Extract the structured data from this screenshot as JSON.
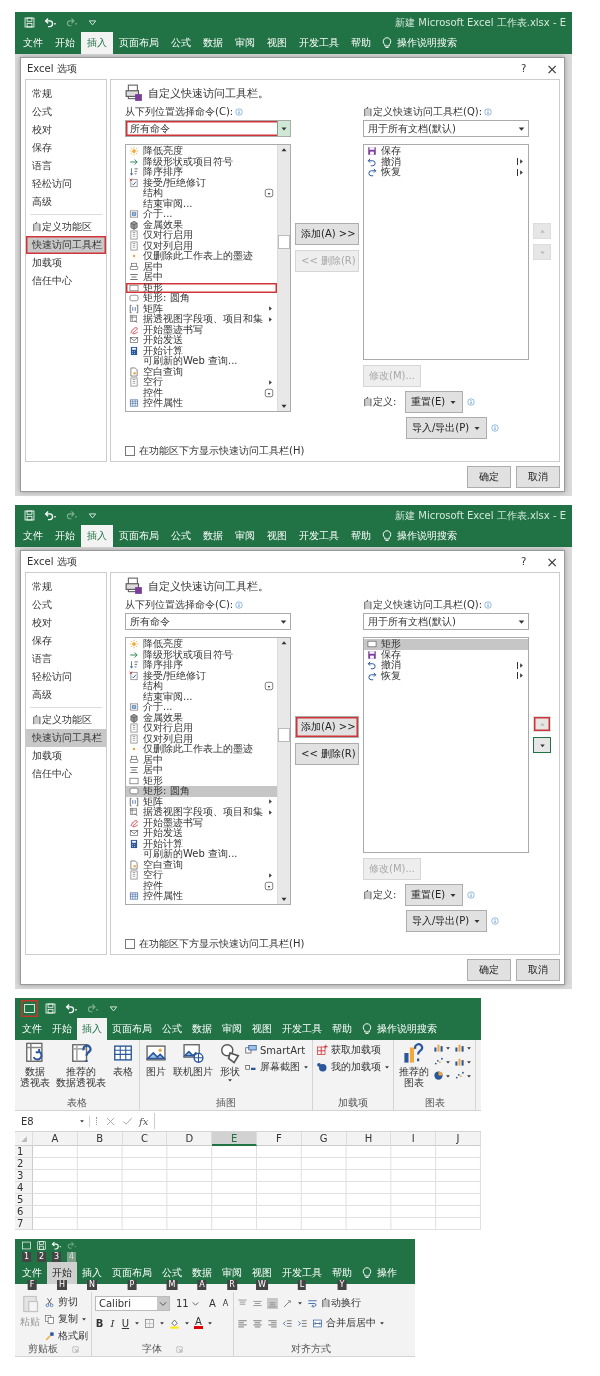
{
  "screens": [
    {
      "kind": "options",
      "document_title": "新建 Microsoft Excel 工作表.xlsx - E",
      "qat": [
        {
          "kind": "save",
          "highlighted": false
        },
        {
          "kind": "undo",
          "highlighted": false
        },
        {
          "kind": "redo",
          "highlighted": false
        },
        {
          "kind": "customize",
          "highlighted": false
        }
      ],
      "tabs": [
        {
          "label": "文件",
          "selected": false
        },
        {
          "label": "开始",
          "selected": false
        },
        {
          "label": "插入",
          "selected": true
        },
        {
          "label": "页面布局",
          "selected": false
        },
        {
          "label": "公式",
          "selected": false
        },
        {
          "label": "数据",
          "selected": false
        },
        {
          "label": "审阅",
          "selected": false
        },
        {
          "label": "视图",
          "selected": false
        },
        {
          "label": "开发工具",
          "selected": false
        },
        {
          "label": "帮助",
          "selected": false
        }
      ],
      "search": "操作说明搜索",
      "dialog": {
        "title": "Excel 选项",
        "help": "?",
        "close": "×",
        "nav_groups": [
          [
            {
              "label": "常规",
              "selected": false,
              "highlighted": false
            },
            {
              "label": "公式",
              "selected": false,
              "highlighted": false
            },
            {
              "label": "校对",
              "selected": false,
              "highlighted": false
            },
            {
              "label": "保存",
              "selected": false,
              "highlighted": false
            },
            {
              "label": "语言",
              "selected": false,
              "highlighted": false
            },
            {
              "label": "轻松访问",
              "selected": false,
              "highlighted": false
            },
            {
              "label": "高级",
              "selected": false,
              "highlighted": false
            }
          ],
          [
            {
              "label": "自定义功能区",
              "selected": false,
              "highlighted": false
            },
            {
              "label": "快速访问工具栏",
              "selected": true,
              "highlighted": true
            },
            {
              "label": "加载项",
              "selected": false,
              "highlighted": false
            },
            {
              "label": "信任中心",
              "selected": false,
              "highlighted": false
            }
          ]
        ],
        "heading": "自定义快速访问工具栏。",
        "source_label": "从下列位置选择命令(C):",
        "source": {
          "value": "所有命令",
          "highlighted": true
        },
        "target_label": "自定义快速访问工具栏(Q):",
        "target": {
          "value": "用于所有文档(默认)",
          "highlighted": false
        },
        "commands": [
          {
            "label": "降低亮度",
            "kind": "sun",
            "submenu": false,
            "split": false,
            "selected": false,
            "highlighted": false
          },
          {
            "label": "降级形状或项目符号",
            "kind": "arrow",
            "submenu": false,
            "split": false,
            "selected": false,
            "highlighted": false
          },
          {
            "label": "降序排序",
            "kind": "sort",
            "submenu": false,
            "split": false,
            "selected": false,
            "highlighted": false
          },
          {
            "label": "接受/拒绝修订",
            "kind": "check",
            "submenu": false,
            "split": false,
            "selected": false,
            "highlighted": false
          },
          {
            "label": "结构",
            "kind": "none",
            "submenu": false,
            "split": true,
            "selected": false,
            "highlighted": false
          },
          {
            "label": "结束审阅...",
            "kind": "none",
            "submenu": false,
            "split": false,
            "selected": false,
            "highlighted": false
          },
          {
            "label": "介于...",
            "kind": "frame",
            "submenu": false,
            "split": false,
            "selected": false,
            "highlighted": false
          },
          {
            "label": "金属效果",
            "kind": "cube",
            "submenu": false,
            "split": false,
            "selected": false,
            "highlighted": false
          },
          {
            "label": "仅对行启用",
            "kind": "page",
            "submenu": false,
            "split": false,
            "selected": false,
            "highlighted": false
          },
          {
            "label": "仅对列启用",
            "kind": "page",
            "submenu": false,
            "split": false,
            "selected": false,
            "highlighted": false
          },
          {
            "label": "仅删除此工作表上的墨迹",
            "kind": "dot",
            "submenu": false,
            "split": false,
            "selected": false,
            "highlighted": false
          },
          {
            "label": "居中",
            "kind": "print",
            "submenu": false,
            "split": false,
            "selected": false,
            "highlighted": false
          },
          {
            "label": "居中",
            "kind": "lines",
            "submenu": false,
            "split": false,
            "selected": false,
            "highlighted": false
          },
          {
            "label": "矩形",
            "kind": "rect",
            "submenu": false,
            "split": false,
            "selected": false,
            "highlighted": true
          },
          {
            "label": "矩形: 圆角",
            "kind": "roundrect",
            "submenu": false,
            "split": false,
            "selected": false,
            "highlighted": false
          },
          {
            "label": "矩阵",
            "kind": "bracket",
            "submenu": true,
            "split": false,
            "selected": false,
            "highlighted": false
          },
          {
            "label": "据透视图字段项、项目和集",
            "kind": "pivot",
            "submenu": true,
            "split": false,
            "selected": false,
            "highlighted": false
          },
          {
            "label": "开始墨迹书写",
            "kind": "ink",
            "submenu": false,
            "split": false,
            "selected": false,
            "highlighted": false
          },
          {
            "label": "开始发送",
            "kind": "send",
            "submenu": false,
            "split": false,
            "selected": false,
            "highlighted": false
          },
          {
            "label": "开始计算",
            "kind": "calc",
            "submenu": false,
            "split": false,
            "selected": false,
            "highlighted": false
          },
          {
            "label": "可刷新的Web 查询...",
            "kind": "none",
            "submenu": false,
            "split": false,
            "selected": false,
            "highlighted": false
          },
          {
            "label": "空白查询",
            "kind": "query",
            "submenu": false,
            "split": false,
            "selected": false,
            "highlighted": false
          },
          {
            "label": "空行",
            "kind": "page",
            "submenu": true,
            "split": false,
            "selected": false,
            "highlighted": false
          },
          {
            "label": "控件",
            "kind": "none",
            "submenu": false,
            "split": true,
            "selected": false,
            "highlighted": false
          },
          {
            "label": "控件属性",
            "kind": "grid",
            "submenu": false,
            "split": false,
            "selected": false,
            "highlighted": false
          }
        ],
        "toolbar": [
          {
            "label": "保存",
            "kind": "save",
            "submenu": false,
            "selected": false
          },
          {
            "label": "撤消",
            "kind": "undo",
            "submenu": true,
            "selected": false
          },
          {
            "label": "恢复",
            "kind": "redo",
            "submenu": true,
            "selected": false
          }
        ],
        "add_button": {
          "label": "添加(A) >>",
          "disabled": false,
          "highlighted": false
        },
        "remove_button": {
          "label": "<< 删除(R)",
          "disabled": true,
          "highlighted": false
        },
        "modify_button": {
          "label": "修改(M)...",
          "disabled": true
        },
        "customize_label": "自定义:",
        "reset_button": "重置(E)",
        "import_button": "导入/导出(P)",
        "move_up": {
          "disabled": true,
          "highlighted": false,
          "focused": false
        },
        "move_down": {
          "disabled": true,
          "highlighted": false,
          "focused": false
        },
        "show_below": {
          "label": "在功能区下方显示快速访问工具栏(H)",
          "checked": false
        },
        "ok": "确定",
        "cancel": "取消"
      }
    },
    {
      "kind": "options",
      "document_title": "新建 Microsoft Excel 工作表.xlsx - E",
      "qat": [
        {
          "kind": "save",
          "highlighted": false
        },
        {
          "kind": "undo",
          "highlighted": false
        },
        {
          "kind": "redo",
          "highlighted": false
        },
        {
          "kind": "customize",
          "highlighted": false
        }
      ],
      "tabs": [
        {
          "label": "文件",
          "selected": false
        },
        {
          "label": "开始",
          "selected": false
        },
        {
          "label": "插入",
          "selected": true
        },
        {
          "label": "页面布局",
          "selected": false
        },
        {
          "label": "公式",
          "selected": false
        },
        {
          "label": "数据",
          "selected": false
        },
        {
          "label": "审阅",
          "selected": false
        },
        {
          "label": "视图",
          "selected": false
        },
        {
          "label": "开发工具",
          "selected": false
        },
        {
          "label": "帮助",
          "selected": false
        }
      ],
      "search": "操作说明搜索",
      "dialog": {
        "title": "Excel 选项",
        "help": "?",
        "close": "×",
        "nav_groups": [
          [
            {
              "label": "常规",
              "selected": false,
              "highlighted": false
            },
            {
              "label": "公式",
              "selected": false,
              "highlighted": false
            },
            {
              "label": "校对",
              "selected": false,
              "highlighted": false
            },
            {
              "label": "保存",
              "selected": false,
              "highlighted": false
            },
            {
              "label": "语言",
              "selected": false,
              "highlighted": false
            },
            {
              "label": "轻松访问",
              "selected": false,
              "highlighted": false
            },
            {
              "label": "高级",
              "selected": false,
              "highlighted": false
            }
          ],
          [
            {
              "label": "自定义功能区",
              "selected": false,
              "highlighted": false
            },
            {
              "label": "快速访问工具栏",
              "selected": true,
              "highlighted": false
            },
            {
              "label": "加载项",
              "selected": false,
              "highlighted": false
            },
            {
              "label": "信任中心",
              "selected": false,
              "highlighted": false
            }
          ]
        ],
        "heading": "自定义快速访问工具栏。",
        "source_label": "从下列位置选择命令(C):",
        "source": {
          "value": "所有命令",
          "highlighted": false
        },
        "target_label": "自定义快速访问工具栏(Q):",
        "target": {
          "value": "用于所有文档(默认)",
          "highlighted": false
        },
        "commands": [
          {
            "label": "降低亮度",
            "kind": "sun",
            "submenu": false,
            "split": false,
            "selected": false,
            "highlighted": false
          },
          {
            "label": "降级形状或项目符号",
            "kind": "arrow",
            "submenu": false,
            "split": false,
            "selected": false,
            "highlighted": false
          },
          {
            "label": "降序排序",
            "kind": "sort",
            "submenu": false,
            "split": false,
            "selected": false,
            "highlighted": false
          },
          {
            "label": "接受/拒绝修订",
            "kind": "check",
            "submenu": false,
            "split": false,
            "selected": false,
            "highlighted": false
          },
          {
            "label": "结构",
            "kind": "none",
            "submenu": false,
            "split": true,
            "selected": false,
            "highlighted": false
          },
          {
            "label": "结束审阅...",
            "kind": "none",
            "submenu": false,
            "split": false,
            "selected": false,
            "highlighted": false
          },
          {
            "label": "介于...",
            "kind": "frame",
            "submenu": false,
            "split": false,
            "selected": false,
            "highlighted": false
          },
          {
            "label": "金属效果",
            "kind": "cube",
            "submenu": false,
            "split": false,
            "selected": false,
            "highlighted": false
          },
          {
            "label": "仅对行启用",
            "kind": "page",
            "submenu": false,
            "split": false,
            "selected": false,
            "highlighted": false
          },
          {
            "label": "仅对列启用",
            "kind": "page",
            "submenu": false,
            "split": false,
            "selected": false,
            "highlighted": false
          },
          {
            "label": "仅删除此工作表上的墨迹",
            "kind": "dot",
            "submenu": false,
            "split": false,
            "selected": false,
            "highlighted": false
          },
          {
            "label": "居中",
            "kind": "print",
            "submenu": false,
            "split": false,
            "selected": false,
            "highlighted": false
          },
          {
            "label": "居中",
            "kind": "lines",
            "submenu": false,
            "split": false,
            "selected": false,
            "highlighted": false
          },
          {
            "label": "矩形",
            "kind": "rect",
            "submenu": false,
            "split": false,
            "selected": false,
            "highlighted": false
          },
          {
            "label": "矩形: 圆角",
            "kind": "roundrect",
            "submenu": false,
            "split": false,
            "selected": true,
            "highlighted": false
          },
          {
            "label": "矩阵",
            "kind": "bracket",
            "submenu": true,
            "split": false,
            "selected": false,
            "highlighted": false
          },
          {
            "label": "据透视图字段项、项目和集",
            "kind": "pivot",
            "submenu": true,
            "split": false,
            "selected": false,
            "highlighted": false
          },
          {
            "label": "开始墨迹书写",
            "kind": "ink",
            "submenu": false,
            "split": false,
            "selected": false,
            "highlighted": false
          },
          {
            "label": "开始发送",
            "kind": "send",
            "submenu": false,
            "split": false,
            "selected": false,
            "highlighted": false
          },
          {
            "label": "开始计算",
            "kind": "calc",
            "submenu": false,
            "split": false,
            "selected": false,
            "highlighted": false
          },
          {
            "label": "可刷新的Web 查询...",
            "kind": "none",
            "submenu": false,
            "split": false,
            "selected": false,
            "highlighted": false
          },
          {
            "label": "空白查询",
            "kind": "query",
            "submenu": false,
            "split": false,
            "selected": false,
            "highlighted": false
          },
          {
            "label": "空行",
            "kind": "page",
            "submenu": true,
            "split": false,
            "selected": false,
            "highlighted": false
          },
          {
            "label": "控件",
            "kind": "none",
            "submenu": false,
            "split": true,
            "selected": false,
            "highlighted": false
          },
          {
            "label": "控件属性",
            "kind": "grid",
            "submenu": false,
            "split": false,
            "selected": false,
            "highlighted": false
          }
        ],
        "toolbar": [
          {
            "label": "矩形",
            "kind": "rect",
            "submenu": false,
            "selected": true
          },
          {
            "label": "保存",
            "kind": "save",
            "submenu": false,
            "selected": false
          },
          {
            "label": "撤消",
            "kind": "undo",
            "submenu": true,
            "selected": false
          },
          {
            "label": "恢复",
            "kind": "redo",
            "submenu": true,
            "selected": false
          }
        ],
        "add_button": {
          "label": "添加(A) >>",
          "disabled": false,
          "highlighted": true
        },
        "remove_button": {
          "label": "<< 删除(R)",
          "disabled": false,
          "highlighted": false
        },
        "modify_button": {
          "label": "修改(M)...",
          "disabled": true
        },
        "customize_label": "自定义:",
        "reset_button": "重置(E)",
        "import_button": "导入/导出(P)",
        "move_up": {
          "disabled": true,
          "highlighted": true,
          "focused": false
        },
        "move_down": {
          "disabled": false,
          "highlighted": false,
          "focused": true
        },
        "show_below": {
          "label": "在功能区下方显示快速访问工具栏(H)",
          "checked": false
        },
        "ok": "确定",
        "cancel": "取消"
      }
    },
    {
      "kind": "insert_ribbon",
      "qat": [
        {
          "kind": "rect",
          "highlighted": true
        },
        {
          "kind": "save",
          "highlighted": false
        },
        {
          "kind": "undo",
          "highlighted": false
        },
        {
          "kind": "redo",
          "highlighted": false
        },
        {
          "kind": "customize",
          "highlighted": false
        }
      ],
      "tabs": [
        {
          "label": "文件",
          "selected": false
        },
        {
          "label": "开始",
          "selected": false
        },
        {
          "label": "插入",
          "selected": true
        },
        {
          "label": "页面布局",
          "selected": false
        },
        {
          "label": "公式",
          "selected": false
        },
        {
          "label": "数据",
          "selected": false
        },
        {
          "label": "审阅",
          "selected": false
        },
        {
          "label": "视图",
          "selected": false
        },
        {
          "label": "开发工具",
          "selected": false
        },
        {
          "label": "帮助",
          "selected": false
        }
      ],
      "search": "操作说明搜索",
      "groups": [
        {
          "label": "表格",
          "large": [
            {
              "lines": [
                "数据",
                "透视表"
              ],
              "kind": "pivotbig",
              "dropdown": false
            },
            {
              "lines": [
                "推荐的",
                "数据透视表"
              ],
              "kind": "recommend",
              "dropdown": false
            },
            {
              "lines": [
                "表格"
              ],
              "kind": "grid",
              "dropdown": false
            }
          ]
        },
        {
          "label": "插图",
          "large": [
            {
              "lines": [
                "图片"
              ],
              "kind": "picture",
              "dropdown": false
            },
            {
              "lines": [
                "联机图片"
              ],
              "kind": "online",
              "dropdown": false
            },
            {
              "lines": [
                "形状"
              ],
              "kind": "shapes",
              "dropdown": true
            }
          ],
          "small": [
            {
              "label": "SmartArt",
              "kind": "smartart",
              "dropdown": false
            },
            {
              "label": "屏幕截图",
              "kind": "screenshot",
              "dropdown": true
            }
          ]
        },
        {
          "label": "加载项",
          "small": [
            {
              "label": "获取加载项",
              "kind": "addin",
              "dropdown": false
            },
            {
              "label": "我的加载项",
              "kind": "myaddin",
              "dropdown": true
            }
          ]
        },
        {
          "label": "图表",
          "large": [
            {
              "lines": [
                "推荐的",
                "图表"
              ],
              "kind": "recchart",
              "dropdown": false
            }
          ],
          "icons": [
            {
              "kind": "colchart",
              "dropdown": true
            },
            {
              "kind": "colchart",
              "dropdown": true
            },
            {
              "kind": "scatter",
              "dropdown": true
            },
            {
              "kind": "colchart",
              "dropdown": true
            },
            {
              "kind": "pie",
              "dropdown": true
            },
            {
              "kind": "scatter",
              "dropdown": true
            }
          ]
        }
      ],
      "name_box": "E8",
      "function_label": "fx",
      "columns": [
        {
          "label": "A",
          "selected": false
        },
        {
          "label": "B",
          "selected": false
        },
        {
          "label": "C",
          "selected": false
        },
        {
          "label": "D",
          "selected": false
        },
        {
          "label": "E",
          "selected": true
        },
        {
          "label": "F",
          "selected": false
        },
        {
          "label": "G",
          "selected": false
        },
        {
          "label": "H",
          "selected": false
        },
        {
          "label": "I",
          "selected": false
        },
        {
          "label": "J",
          "selected": false
        }
      ],
      "rows": [
        "1",
        "2",
        "3",
        "4",
        "5",
        "6",
        "7"
      ]
    },
    {
      "kind": "home_keytips",
      "qat": [
        {
          "kind": "rect",
          "keytip": "1",
          "disabled": false
        },
        {
          "kind": "save",
          "keytip": "2",
          "disabled": false
        },
        {
          "kind": "undo",
          "keytip": "3",
          "disabled": false
        },
        {
          "kind": "redo",
          "keytip": "4",
          "disabled": true
        }
      ],
      "tabs": [
        {
          "label": "文件",
          "selected": false,
          "keytip": "F"
        },
        {
          "label": "开始",
          "selected": true,
          "keytip": "H"
        },
        {
          "label": "插入",
          "selected": false,
          "keytip": "N"
        },
        {
          "label": "页面布局",
          "selected": false,
          "keytip": "P"
        },
        {
          "label": "公式",
          "selected": false,
          "keytip": "M"
        },
        {
          "label": "数据",
          "selected": false,
          "keytip": "A"
        },
        {
          "label": "审阅",
          "selected": false,
          "keytip": "R"
        },
        {
          "label": "视图",
          "selected": false,
          "keytip": "W"
        },
        {
          "label": "开发工具",
          "selected": false,
          "keytip": "L"
        },
        {
          "label": "帮助",
          "selected": false,
          "keytip": "Y"
        }
      ],
      "search": "操作",
      "clipboard": {
        "label": "剪贴板",
        "paste": "粘贴",
        "cut": "剪切",
        "copy": "复制",
        "format_painter": "格式刷"
      },
      "font": {
        "label": "字体",
        "name": "Calibri",
        "size": "11",
        "grow": "A",
        "shrink": "A",
        "bold": "B",
        "italic": "I",
        "underline": "U",
        "font_color": "A"
      },
      "alignment": {
        "label": "对齐方式",
        "wrap": "自动换行",
        "merge": "合并后居中"
      }
    }
  ]
}
